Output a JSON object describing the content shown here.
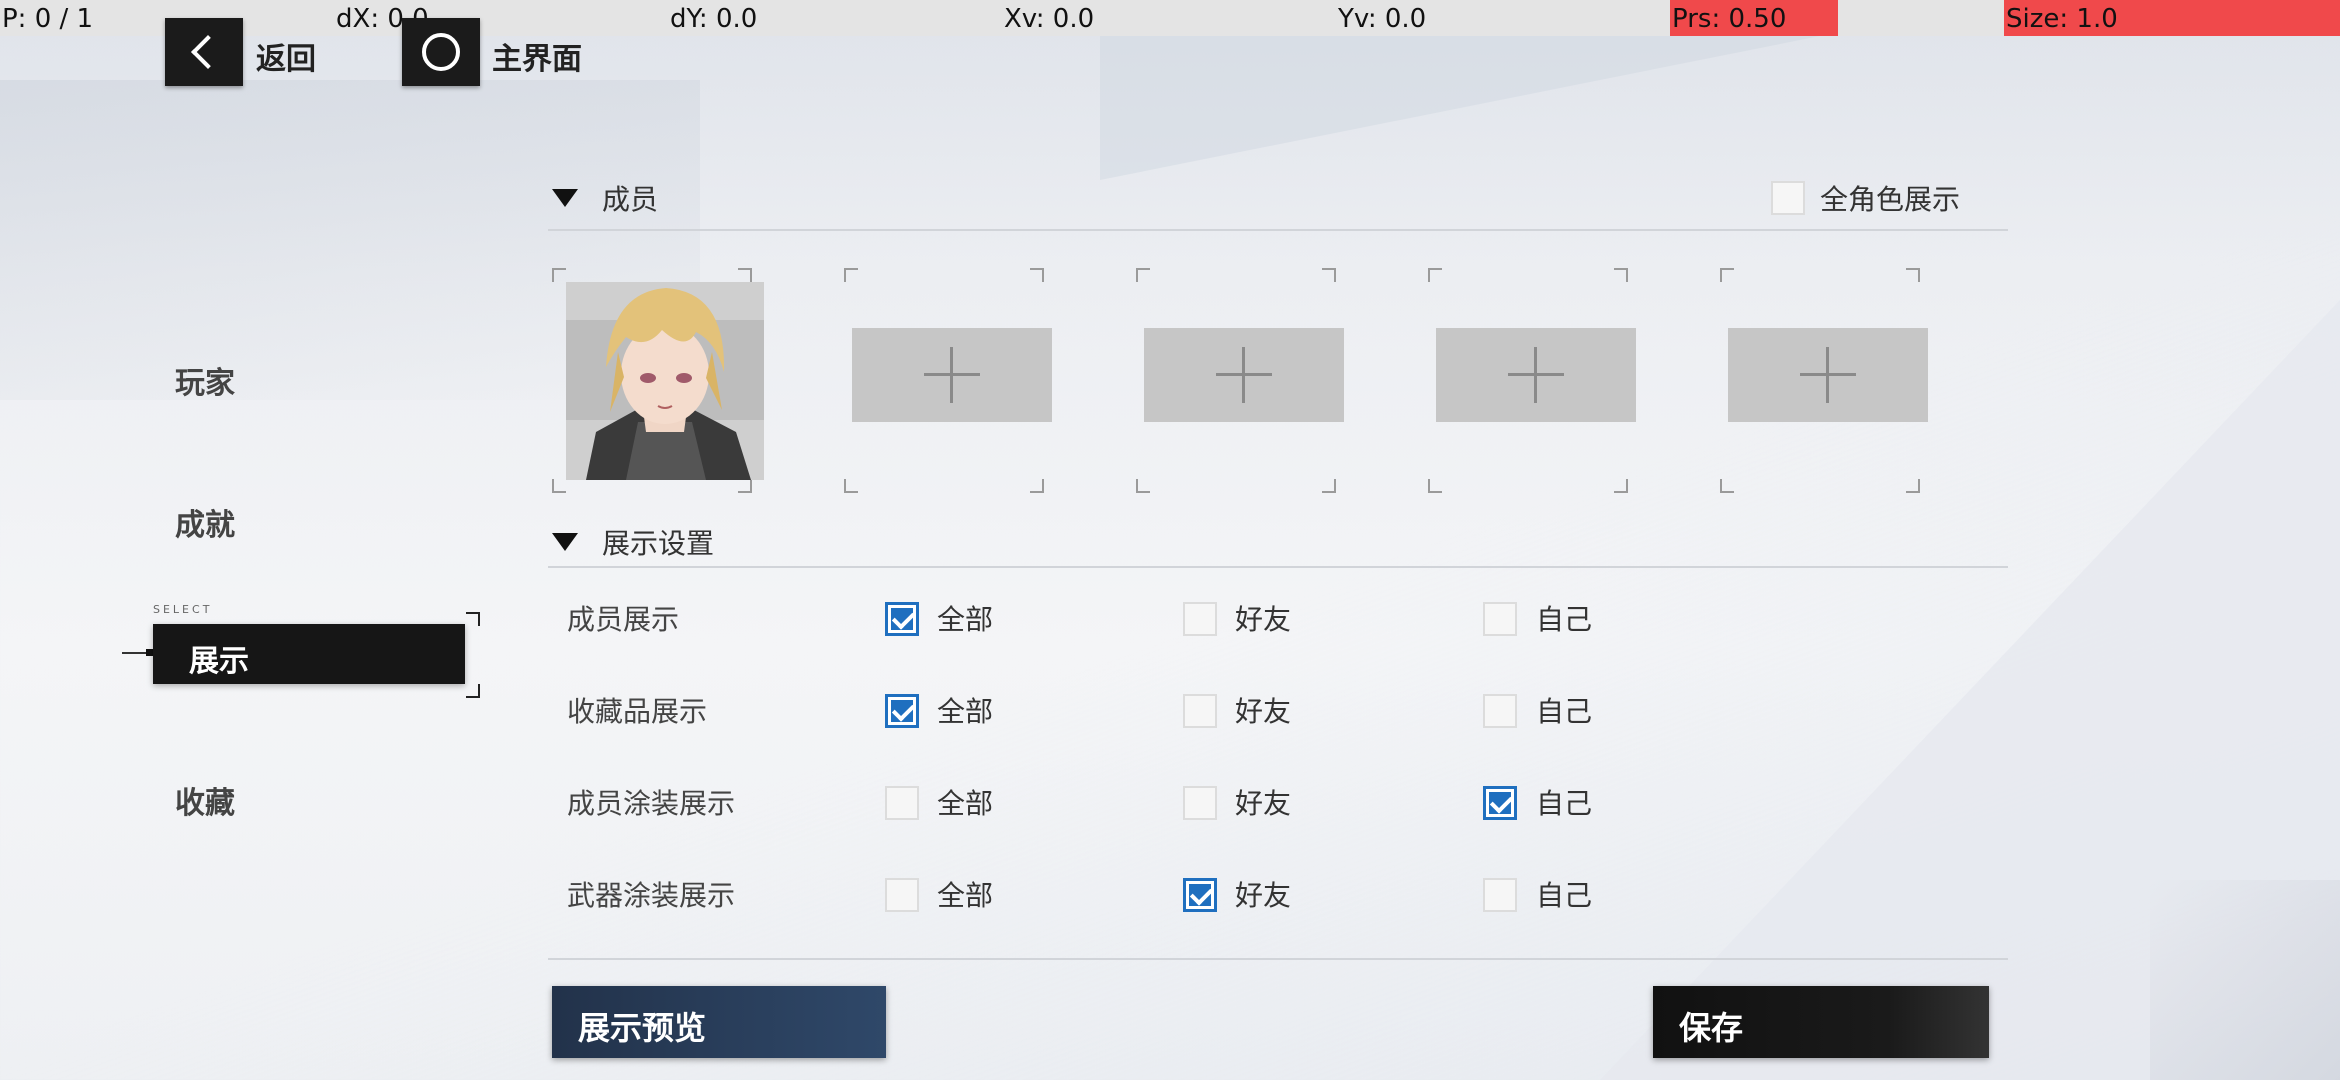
{
  "status_bar": {
    "p": "P: 0 / 1",
    "dx": "dX: 0.0",
    "dy": "dY: 0.0",
    "xv": "Xv: 0.0",
    "yv": "Yv: 0.0",
    "prs": "Prs: 0.50",
    "size": "Size: 1.0"
  },
  "nav": {
    "back_label": "返回",
    "home_label": "主界面"
  },
  "sidebar": {
    "items": [
      {
        "label": "玩家"
      },
      {
        "label": "成就"
      },
      {
        "label": "展示",
        "active": true
      },
      {
        "label": "收藏"
      }
    ],
    "select_tag": "SELECT"
  },
  "members": {
    "title": "成员",
    "all_chars_label": "全角色展示",
    "all_chars_checked": false
  },
  "display_settings": {
    "title": "展示设置",
    "options": [
      "全部",
      "好友",
      "自己"
    ],
    "rows": [
      {
        "label": "成员展示",
        "selected": 0
      },
      {
        "label": "收藏品展示",
        "selected": 0
      },
      {
        "label": "成员涂装展示",
        "selected": 2
      },
      {
        "label": "武器涂装展示",
        "selected": 1
      }
    ]
  },
  "buttons": {
    "preview": "展示预览",
    "save": "保存"
  },
  "colors": {
    "checkbox_on": "#1f6fbf",
    "status_red": "#f0494b",
    "preview_button": "#2a4060"
  }
}
